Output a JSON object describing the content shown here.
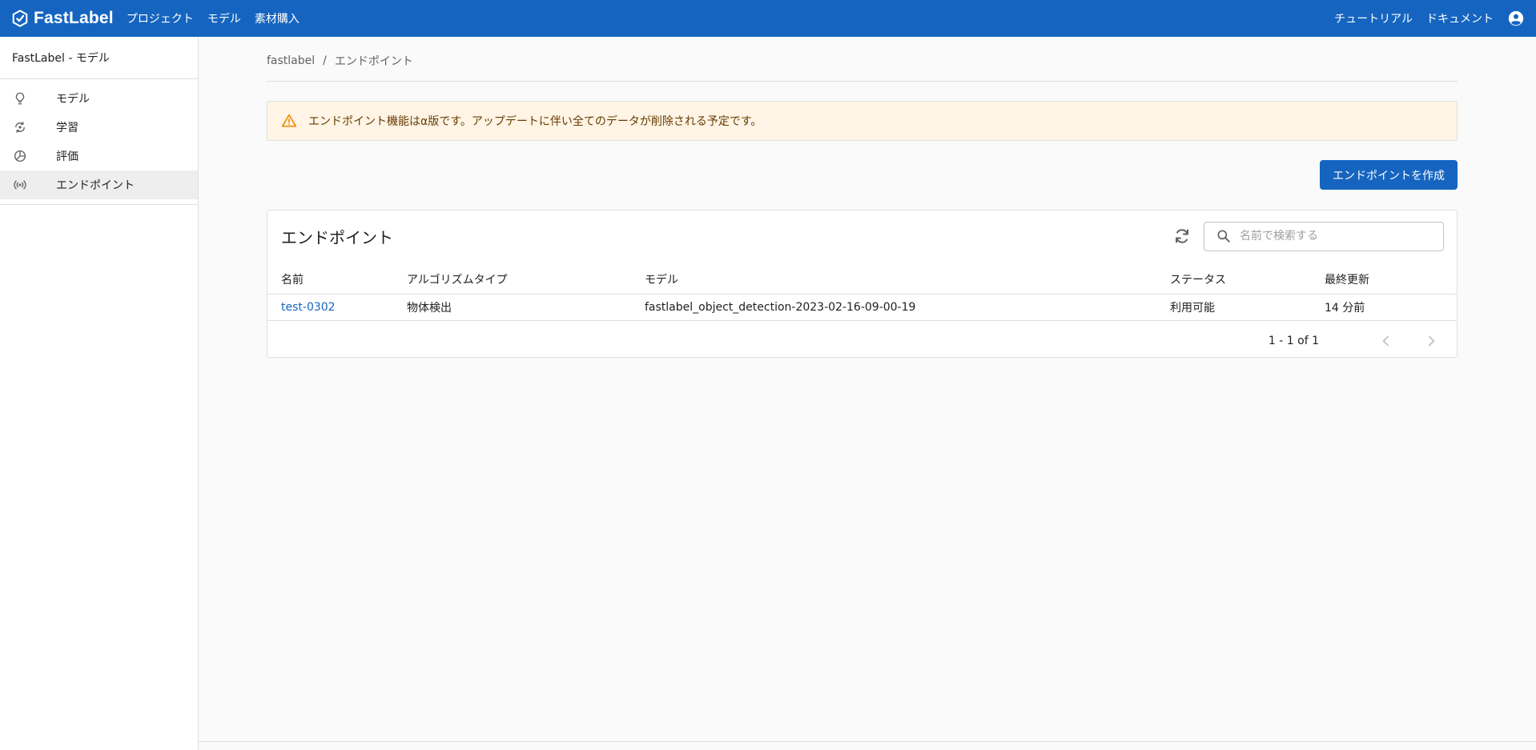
{
  "header": {
    "brand": "FastLabel",
    "nav": [
      "プロジェクト",
      "モデル",
      "素材購入"
    ],
    "tutorial": "チュートリアル",
    "docs": "ドキュメント",
    "colors": {
      "primary": "#1565c0"
    }
  },
  "sidebar": {
    "title": "FastLabel - モデル",
    "items": [
      {
        "label": "モデル",
        "icon": "lightbulb-icon"
      },
      {
        "label": "学習",
        "icon": "training-icon"
      },
      {
        "label": "評価",
        "icon": "pie-chart-icon"
      },
      {
        "label": "エンドポイント",
        "icon": "broadcast-icon",
        "active": true
      }
    ]
  },
  "breadcrumb": {
    "root": "fastlabel",
    "sep": "/",
    "current": "エンドポイント"
  },
  "alert": {
    "text": "エンドポイント機能はα版です。アップデートに伴い全てのデータが削除される予定です。",
    "icon": "warning-icon"
  },
  "actions": {
    "create_label": "エンドポイントを作成"
  },
  "table": {
    "title": "エンドポイント",
    "search_placeholder": "名前で検索する",
    "columns": [
      "名前",
      "アルゴリズムタイプ",
      "モデル",
      "ステータス",
      "最終更新"
    ],
    "rows": [
      {
        "name": "test-0302",
        "algorithm": "物体検出",
        "model": "fastlabel_object_detection-2023-02-16-09-00-19",
        "status": "利用可能",
        "updated": "14 分前"
      }
    ],
    "pagination": "1 - 1 of 1"
  }
}
